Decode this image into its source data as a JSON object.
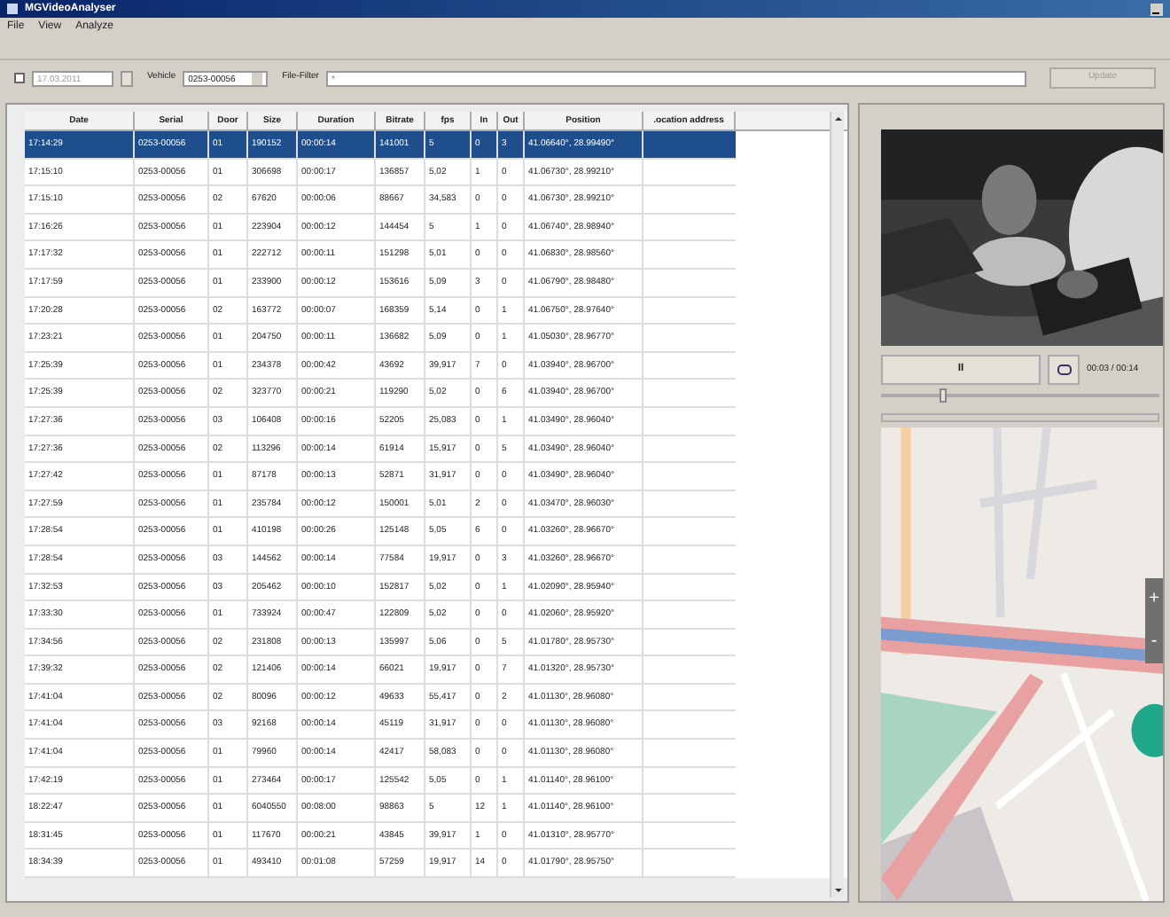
{
  "window": {
    "title": "MGVideoAnalyser"
  },
  "menu": [
    "File",
    "View",
    "Analyze"
  ],
  "toolbar": {
    "date_enabled": false,
    "date": "17.03.2011",
    "vehicle_label": "Vehicle",
    "vehicle": "0253-00056",
    "filter_label": "File-Filter",
    "filter": "*",
    "update": "Update",
    "update_disabled": true
  },
  "table": {
    "columns": [
      "Date",
      "Serial",
      "Door",
      "Size",
      "Duration",
      "Bitrate",
      "fps",
      "In",
      "Out",
      "Position",
      ".ocation address"
    ],
    "rows": [
      {
        "selected": true,
        "cells": [
          "17:14:29",
          "0253-00056",
          "01",
          "190152",
          "00:00:14",
          "141001",
          "5",
          "0",
          "3",
          "41.06640°, 28.99490°"
        ]
      },
      {
        "selected": false,
        "cells": [
          "17:15:10",
          "0253-00056",
          "01",
          "306698",
          "00:00:17",
          "136857",
          "5,02",
          "1",
          "0",
          "41.06730°, 28.99210°"
        ]
      },
      {
        "selected": false,
        "cells": [
          "17:15:10",
          "0253-00056",
          "02",
          "67620",
          "00:00:06",
          "88667",
          "34,583",
          "0",
          "0",
          "41.06730°, 28.99210°"
        ]
      },
      {
        "selected": false,
        "cells": [
          "17:16:26",
          "0253-00056",
          "01",
          "223904",
          "00:00:12",
          "144454",
          "5",
          "1",
          "0",
          "41.06740°, 28.98940°"
        ]
      },
      {
        "selected": false,
        "cells": [
          "17:17:32",
          "0253-00056",
          "01",
          "222712",
          "00:00:11",
          "151298",
          "5,01",
          "0",
          "0",
          "41.06830°, 28.98560°"
        ]
      },
      {
        "selected": false,
        "cells": [
          "17:17:59",
          "0253-00056",
          "01",
          "233900",
          "00:00:12",
          "153616",
          "5,09",
          "3",
          "0",
          "41.06790°, 28.98480°"
        ]
      },
      {
        "selected": false,
        "cells": [
          "17:20:28",
          "0253-00056",
          "02",
          "163772",
          "00:00:07",
          "168359",
          "5,14",
          "0",
          "1",
          "41.06750°, 28.97640°"
        ]
      },
      {
        "selected": false,
        "cells": [
          "17:23:21",
          "0253-00056",
          "01",
          "204750",
          "00:00:11",
          "136682",
          "5,09",
          "0",
          "1",
          "41.05030°, 28.96770°"
        ]
      },
      {
        "selected": false,
        "cells": [
          "17:25:39",
          "0253-00056",
          "01",
          "234378",
          "00:00:42",
          "43692",
          "39,917",
          "7",
          "0",
          "41.03940°, 28.96700°"
        ]
      },
      {
        "selected": false,
        "cells": [
          "17:25:39",
          "0253-00056",
          "02",
          "323770",
          "00:00:21",
          "119290",
          "5,02",
          "0",
          "6",
          "41.03940°, 28.96700°"
        ]
      },
      {
        "selected": false,
        "cells": [
          "17:27:36",
          "0253-00056",
          "03",
          "106408",
          "00:00:16",
          "52205",
          "25,083",
          "0",
          "1",
          "41.03490°, 28.96040°"
        ]
      },
      {
        "selected": false,
        "cells": [
          "17:27:36",
          "0253-00056",
          "02",
          "113296",
          "00:00:14",
          "61914",
          "15,917",
          "0",
          "5",
          "41.03490°, 28.96040°"
        ]
      },
      {
        "selected": false,
        "cells": [
          "17:27:42",
          "0253-00056",
          "01",
          "87178",
          "00:00:13",
          "52871",
          "31,917",
          "0",
          "0",
          "41.03490°, 28.96040°"
        ]
      },
      {
        "selected": false,
        "cells": [
          "17:27:59",
          "0253-00056",
          "01",
          "235784",
          "00:00:12",
          "150001",
          "5,01",
          "2",
          "0",
          "41.03470°, 28.96030°"
        ]
      },
      {
        "selected": false,
        "cells": [
          "17:28:54",
          "0253-00056",
          "01",
          "410198",
          "00:00:26",
          "125148",
          "5,05",
          "6",
          "0",
          "41.03260°, 28.96670°"
        ]
      },
      {
        "selected": false,
        "cells": [
          "17:28:54",
          "0253-00056",
          "03",
          "144562",
          "00:00:14",
          "77584",
          "19,917",
          "0",
          "3",
          "41.03260°, 28.96670°"
        ]
      },
      {
        "selected": false,
        "cells": [
          "17:32:53",
          "0253-00056",
          "03",
          "205462",
          "00:00:10",
          "152817",
          "5,02",
          "0",
          "1",
          "41.02090°, 28.95940°"
        ]
      },
      {
        "selected": false,
        "cells": [
          "17:33:30",
          "0253-00056",
          "01",
          "733924",
          "00:00:47",
          "122809",
          "5,02",
          "0",
          "0",
          "41.02060°, 28.95920°"
        ]
      },
      {
        "selected": false,
        "cells": [
          "17:34:56",
          "0253-00056",
          "02",
          "231808",
          "00:00:13",
          "135997",
          "5,06",
          "0",
          "5",
          "41.01780°, 28.95730°"
        ]
      },
      {
        "selected": false,
        "cells": [
          "17:39:32",
          "0253-00056",
          "02",
          "121406",
          "00:00:14",
          "66021",
          "19,917",
          "0",
          "7",
          "41.01320°, 28.95730°"
        ]
      },
      {
        "selected": false,
        "cells": [
          "17:41:04",
          "0253-00056",
          "02",
          "80096",
          "00:00:12",
          "49633",
          "55,417",
          "0",
          "2",
          "41.01130°, 28.96080°"
        ]
      },
      {
        "selected": false,
        "cells": [
          "17:41:04",
          "0253-00056",
          "03",
          "92168",
          "00:00:14",
          "45119",
          "31,917",
          "0",
          "0",
          "41.01130°, 28.96080°"
        ]
      },
      {
        "selected": false,
        "cells": [
          "17:41:04",
          "0253-00056",
          "01",
          "79960",
          "00:00:14",
          "42417",
          "58,083",
          "0",
          "0",
          "41.01130°, 28.96080°"
        ]
      },
      {
        "selected": false,
        "cells": [
          "17:42:19",
          "0253-00056",
          "01",
          "273464",
          "00:00:17",
          "125542",
          "5,05",
          "0",
          "1",
          "41.01140°, 28.96100°"
        ]
      },
      {
        "selected": false,
        "cells": [
          "18:22:47",
          "0253-00056",
          "01",
          "6040550",
          "00:08:00",
          "98863",
          "5",
          "12",
          "1",
          "41.01140°, 28.96100°"
        ]
      },
      {
        "selected": false,
        "cells": [
          "18:31:45",
          "0253-00056",
          "01",
          "117670",
          "00:00:21",
          "43845",
          "39,917",
          "1",
          "0",
          "41.01310°, 28.95770°"
        ]
      },
      {
        "selected": false,
        "cells": [
          "18:34:39",
          "0253-00056",
          "01",
          "493410",
          "00:01:08",
          "57259",
          "19,917",
          "14",
          "0",
          "41.01790°, 28.95750°"
        ]
      }
    ]
  },
  "player": {
    "pause": "II",
    "time": "00:03 / 00:14",
    "level": 0.22
  },
  "map": {
    "zoom_in": "+",
    "zoom_out": "-"
  }
}
